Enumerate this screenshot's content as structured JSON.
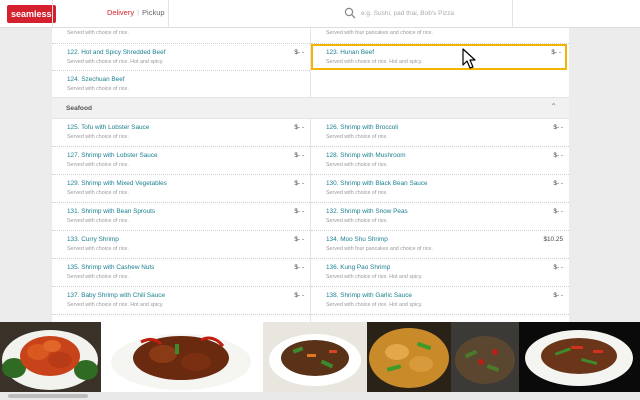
{
  "header": {
    "logo": "seamless",
    "delivery_label": "Delivery",
    "pickup_label": "Pickup",
    "search_placeholder": "e.g. Sushi, pad thai, Bob's Pizza",
    "accent": "#d5202e"
  },
  "menu": {
    "top_items": [
      {
        "name": "",
        "desc": "Served with choice of rice.",
        "price": ""
      },
      {
        "name": "",
        "desc": "Served with four pancakes and choice of rice.",
        "price": ""
      },
      {
        "name": "122. Hot and Spicy Shredded Beef",
        "desc": "Served with choice of rice. Hot and spicy.",
        "price": "$- -"
      },
      {
        "name": "123. Hunan Beef",
        "desc": "Served with choice of rice. Hot and spicy.",
        "price": "$- -"
      },
      {
        "name": "124. Szechuan Beef",
        "desc": "Served with choice of rice.",
        "price": "$- -"
      }
    ],
    "section_title": "Seafood",
    "seafood_items": [
      {
        "name": "125. Tofu with Lobster Sauce",
        "desc": "Served with choice of rice.",
        "price": "$- -"
      },
      {
        "name": "126. Shrimp with Broccoli",
        "desc": "Served with choice of rice.",
        "price": "$- -"
      },
      {
        "name": "127. Shrimp with Lobster Sauce",
        "desc": "Served with choice of rice.",
        "price": "$- -"
      },
      {
        "name": "128. Shrimp with Mushroom",
        "desc": "Served with choice of rice.",
        "price": "$- -"
      },
      {
        "name": "129. Shrimp with Mixed Vegetables",
        "desc": "Served with choice of rice.",
        "price": "$- -"
      },
      {
        "name": "130. Shrimp with Black Bean Sauce",
        "desc": "Served with choice of rice.",
        "price": "$- -"
      },
      {
        "name": "131. Shrimp with Bean Sprouts",
        "desc": "Served with choice of rice.",
        "price": "$- -"
      },
      {
        "name": "132. Shrimp with Snow Peas",
        "desc": "Served with choice of rice.",
        "price": "$- -"
      },
      {
        "name": "133. Curry Shrimp",
        "desc": "Served with choice of rice.",
        "price": "$- -"
      },
      {
        "name": "134. Moo Shu Shrimp",
        "desc": "Served with four pancakes and choice of rice.",
        "price": "$10.25"
      },
      {
        "name": "135. Shrimp with Cashew Nuts",
        "desc": "Served with choice of rice.",
        "price": "$- -"
      },
      {
        "name": "136. Kung Pao Shrimp",
        "desc": "Served with choice of rice. Hot and spicy.",
        "price": "$- -"
      },
      {
        "name": "137. Baby Shrimp with Chili Sauce",
        "desc": "Served with choice of rice. Hot and spicy.",
        "price": "$- -"
      },
      {
        "name": "138. Shrimp with Garlic Sauce",
        "desc": "Served with choice of rice. Hot and spicy.",
        "price": "$- -"
      }
    ],
    "link_color": "#1a7f90",
    "highlight_color": "#f5b400"
  },
  "icons": {
    "search": "search-icon",
    "collapse": "chevron-up-icon",
    "cursor": "mouse-pointer-icon"
  }
}
